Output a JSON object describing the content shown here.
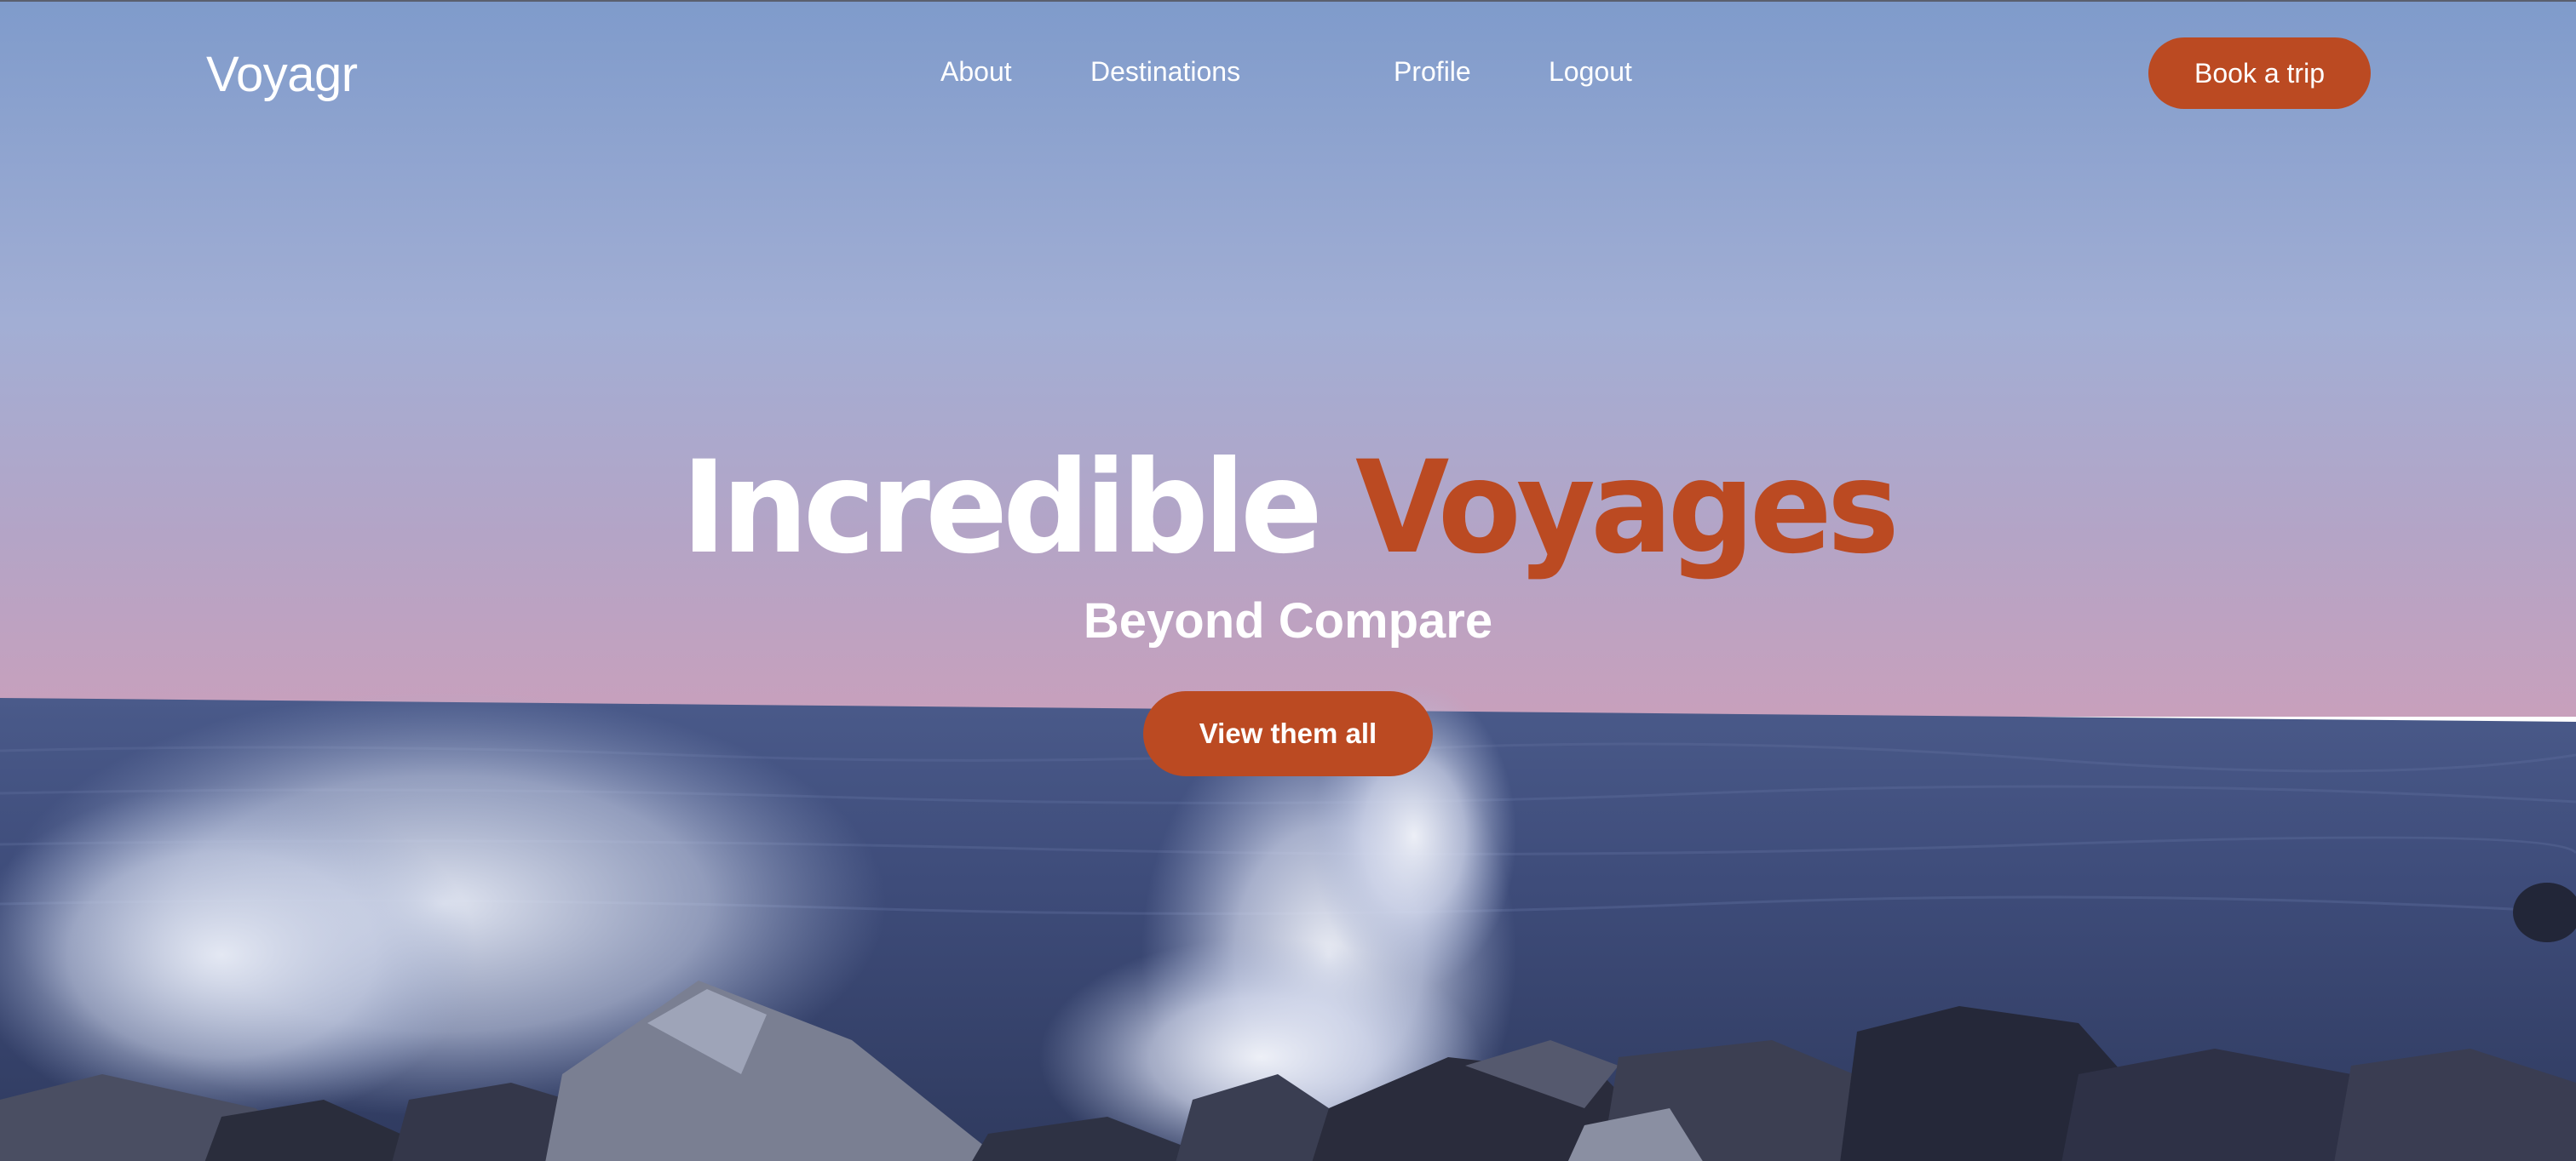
{
  "nav": {
    "logo": "Voyagr",
    "links": [
      "About",
      "Destinations",
      "Profile",
      "Logout"
    ],
    "cta_label": "Book a trip"
  },
  "hero": {
    "title_part1": "Incredible",
    "title_part2": "Voyages",
    "subtitle": "Beyond Compare",
    "button_label": "View them all"
  },
  "colors": {
    "accent": "#bb4a22",
    "text": "#ffffff",
    "sky_top": "#7f9bcb",
    "sky_horizon": "#bfa0c0",
    "sea": "#3a4a75"
  }
}
